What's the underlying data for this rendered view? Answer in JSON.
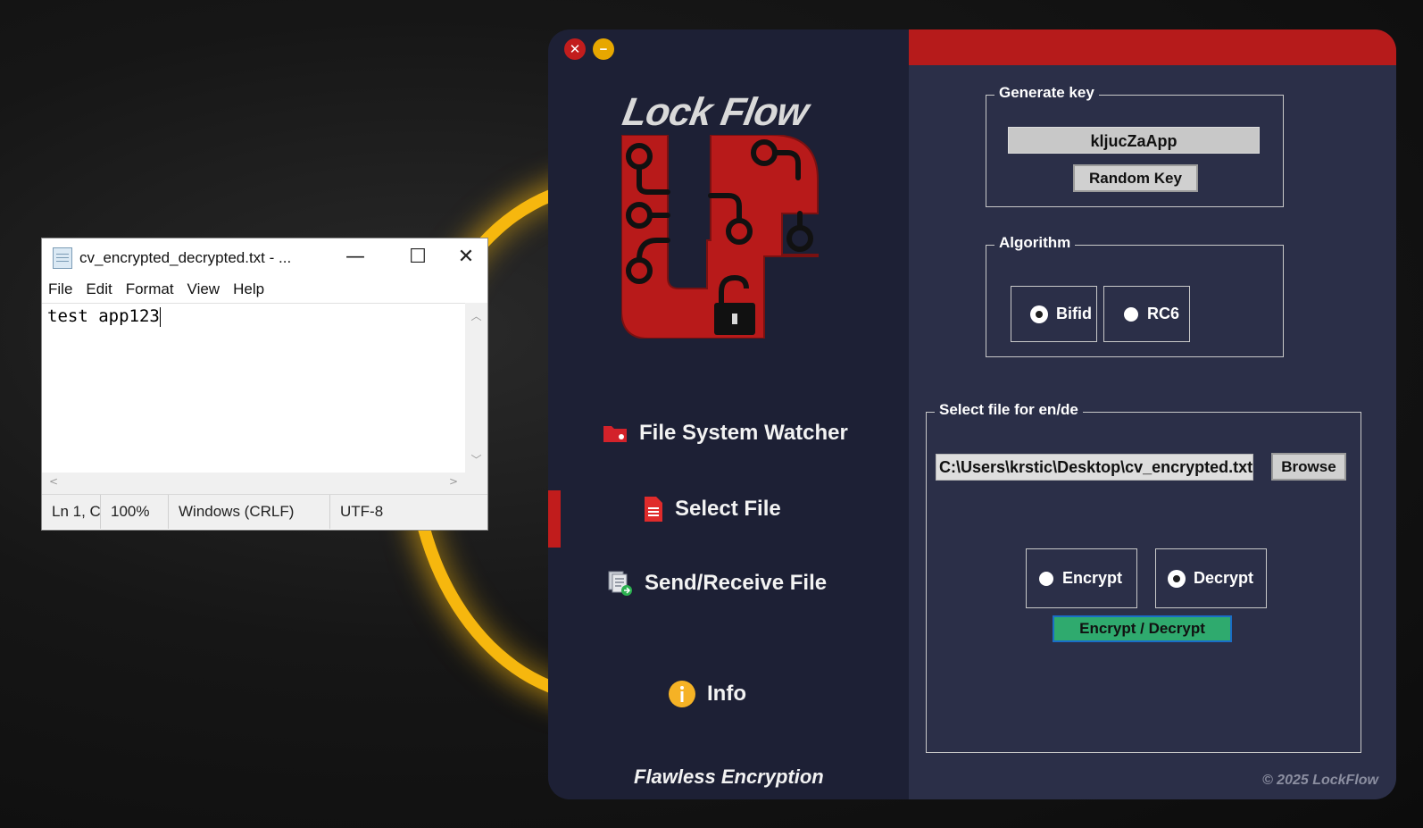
{
  "notepad": {
    "title": "cv_encrypted_decrypted.txt - ...",
    "controls": {
      "minimize": "—",
      "maximize": "☐",
      "close": "✕"
    },
    "menu": [
      "File",
      "Edit",
      "Format",
      "View",
      "Help"
    ],
    "content": "test app123",
    "status": {
      "position": "Ln 1, C",
      "zoom": "100%",
      "line_ending": "Windows (CRLF)",
      "encoding": "UTF-8"
    }
  },
  "app": {
    "brand": "Lock Flow",
    "tagline": "Flawless Encryption",
    "copyright": "© 2025 LockFlow",
    "colors": {
      "accent": "#b61b1b",
      "sidebar": "#1d2035",
      "panel": "#2b2f48",
      "action": "#2faa6e"
    },
    "nav": [
      {
        "label": "File System Watcher",
        "icon": "folder-icon"
      },
      {
        "label": "Select File",
        "icon": "document-icon",
        "active": true
      },
      {
        "label": "Send/Receive File",
        "icon": "file-transfer-icon"
      },
      {
        "label": "Info",
        "icon": "info-icon"
      }
    ],
    "generate_key": {
      "legend": "Generate key",
      "key_value": "kljucZaApp",
      "random_button": "Random Key"
    },
    "algorithm": {
      "legend": "Algorithm",
      "options": [
        "Bifid",
        "RC6"
      ],
      "selected": "Bifid"
    },
    "file_section": {
      "legend": "Select file for en/de",
      "path": "C:\\Users\\krstic\\Desktop\\cv_encrypted.txt",
      "browse_button": "Browse",
      "modes": [
        "Encrypt",
        "Decrypt"
      ],
      "selected_mode": "Decrypt",
      "action_button": "Encrypt / Decrypt"
    }
  }
}
